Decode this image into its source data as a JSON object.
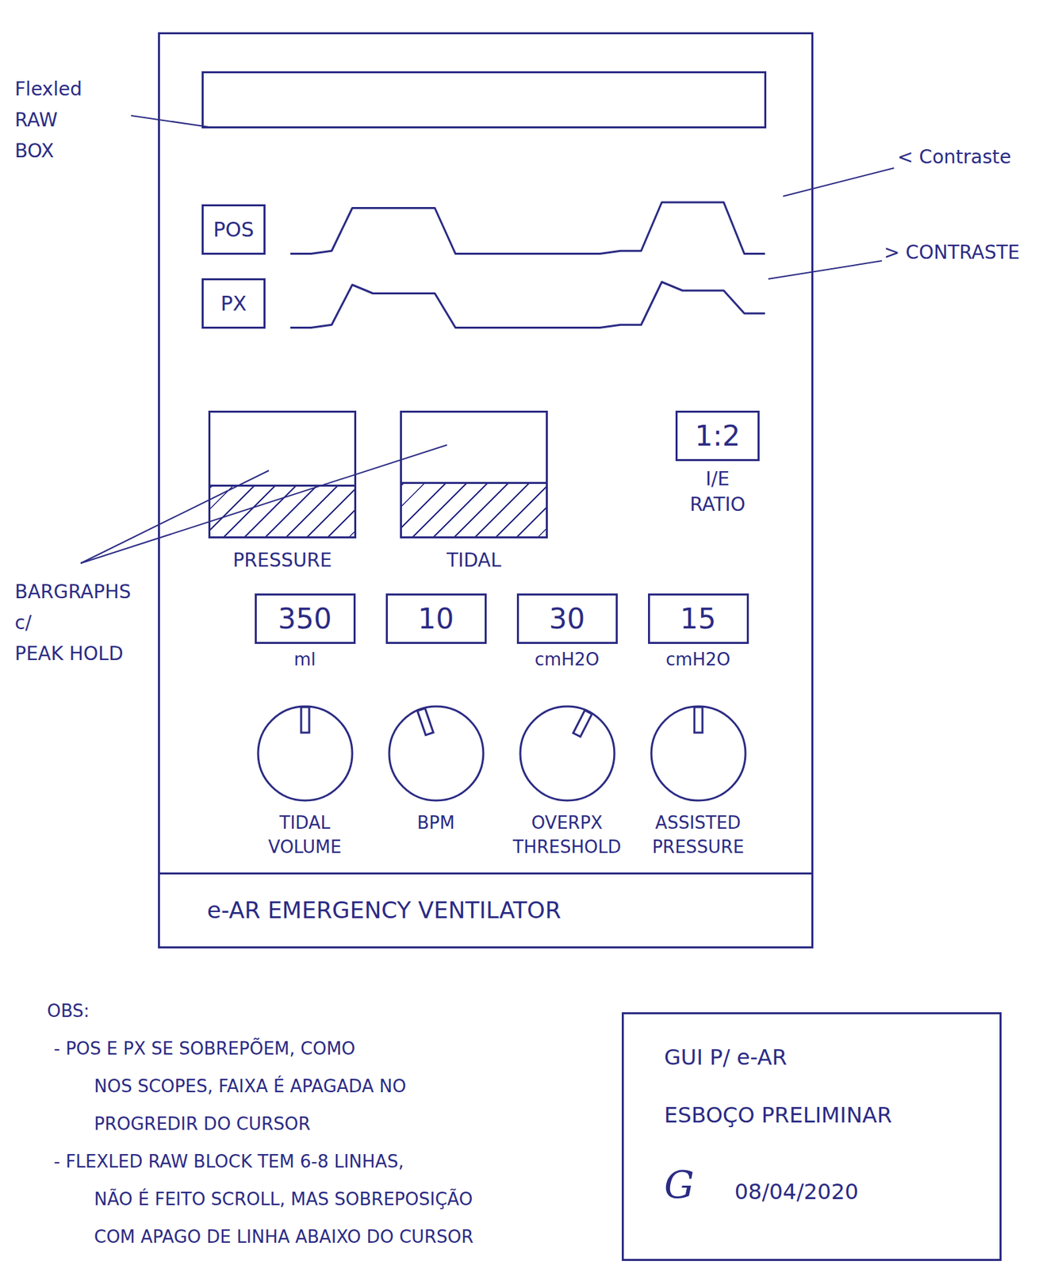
{
  "annotations": {
    "raw_box": [
      "Flexled",
      "RAW",
      "BOX"
    ],
    "contrast_down": "< Contraste",
    "contrast_up": "> CONTRASTE",
    "bargraphs": [
      "BARGRAPHS",
      "c/",
      "PEAK HOLD"
    ]
  },
  "traces": [
    {
      "label": "POS",
      "values": [
        0.1,
        0.1,
        0.15,
        0.9,
        0.9,
        0.9,
        0.9,
        0.9,
        0.1,
        0.1,
        0.1,
        0.1,
        0.1,
        0.1,
        0.1,
        0.1,
        0.15,
        0.15,
        1,
        1,
        1,
        1,
        0.1,
        0.1
      ]
    },
    {
      "label": "PX",
      "values": [
        0.1,
        0.1,
        0.15,
        0.85,
        0.7,
        0.7,
        0.7,
        0.7,
        0.1,
        0.1,
        0.1,
        0.1,
        0.1,
        0.1,
        0.1,
        0.1,
        0.15,
        0.15,
        0.9,
        0.75,
        0.75,
        0.75,
        0.35,
        0.35
      ]
    }
  ],
  "bargraphs": [
    {
      "label": "PRESSURE",
      "level": 0.42
    },
    {
      "label": "TIDAL",
      "level": 0.44
    }
  ],
  "ie_ratio": {
    "value": "1:2",
    "label": [
      "I/E",
      "RATIO"
    ]
  },
  "displays": [
    {
      "value": "350",
      "unit": "ml"
    },
    {
      "value": "10"
    },
    {
      "value": "30",
      "unit": "cmH2O"
    },
    {
      "value": "15",
      "unit": "cmH2O"
    }
  ],
  "knobs": [
    {
      "label": [
        "TIDAL",
        "VOLUME"
      ],
      "level": 0.5
    },
    {
      "label": [
        "BPM"
      ],
      "level": 0.43
    },
    {
      "label": [
        "OVERPX",
        "THRESHOLD"
      ],
      "level": 0.6
    },
    {
      "label": [
        "ASSISTED",
        "PRESSURE"
      ],
      "level": 0.5
    }
  ],
  "footer": "e-AR EMERGENCY VENTILATOR",
  "notes": {
    "title": "OBS:",
    "items": [
      [
        "- POS E PX SE SOBREPÕEM, COMO",
        "NOS SCOPES, FAIXA É APAGADA NO",
        "PROGREDIR DO CURSOR"
      ],
      [
        "- FLEXLED RAW BLOCK TEM 6-8 LINHAS,",
        "NÃO É FEITO SCROLL, MAS SOBREPOSIÇÃO",
        "COM APAGO DE LINHA ABAIXO DO CURSOR"
      ]
    ]
  },
  "title_block": {
    "lines": [
      "GUI P/ e-AR",
      "ESBOÇO PRELIMINAR"
    ],
    "signature": "G",
    "date": "08/04/2020"
  }
}
